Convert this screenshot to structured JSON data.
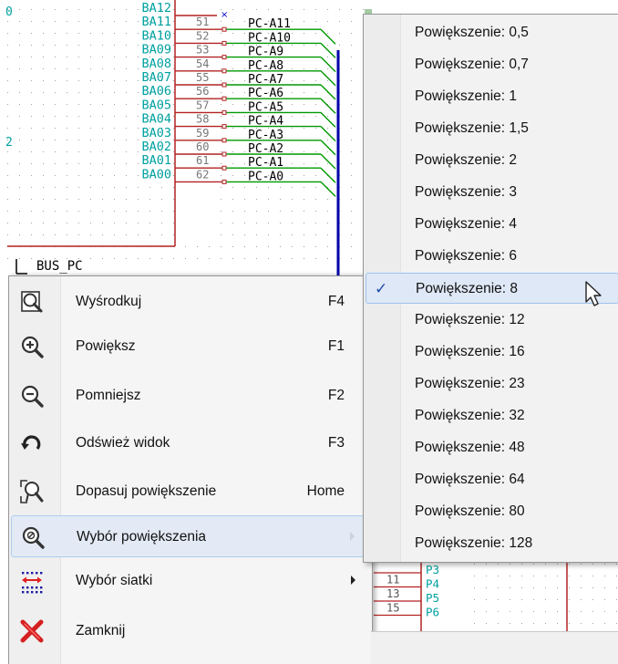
{
  "schematic": {
    "bus_label": "BUS_PC",
    "left_edge_labels": [
      "0",
      "2"
    ],
    "bus_entries": [
      {
        "pin_name": "BA12",
        "pin_num": "",
        "net": ""
      },
      {
        "pin_name": "BA11",
        "pin_num": "51",
        "net": "PC-A11"
      },
      {
        "pin_name": "BA10",
        "pin_num": "52",
        "net": "PC-A10"
      },
      {
        "pin_name": "BA09",
        "pin_num": "53",
        "net": "PC-A9"
      },
      {
        "pin_name": "BA08",
        "pin_num": "54",
        "net": "PC-A8"
      },
      {
        "pin_name": "BA07",
        "pin_num": "55",
        "net": "PC-A7"
      },
      {
        "pin_name": "BA06",
        "pin_num": "56",
        "net": "PC-A6"
      },
      {
        "pin_name": "BA05",
        "pin_num": "57",
        "net": "PC-A5"
      },
      {
        "pin_name": "BA04",
        "pin_num": "58",
        "net": "PC-A4"
      },
      {
        "pin_name": "BA03",
        "pin_num": "59",
        "net": "PC-A3"
      },
      {
        "pin_name": "BA02",
        "pin_num": "60",
        "net": "PC-A2"
      },
      {
        "pin_name": "BA01",
        "pin_num": "61",
        "net": "PC-A1"
      },
      {
        "pin_name": "BA00",
        "pin_num": "62",
        "net": "PC-A0"
      }
    ],
    "lower_pins": [
      {
        "num": "",
        "name": "P3"
      },
      {
        "num": "11",
        "name": "P4"
      },
      {
        "num": "13",
        "name": "P5"
      },
      {
        "num": "15",
        "name": "P6"
      }
    ],
    "colors": {
      "component": "#b22222",
      "wire": "#009900",
      "bus": "#0000aa",
      "pin_text": "#00a0a0",
      "net_text": "#000000",
      "bus_label": "#800080",
      "grid_dot": "#a0a0a0"
    }
  },
  "context_menu": {
    "items": [
      {
        "icon": "zoom-center-icon",
        "label": "Wyśrodkuj",
        "shortcut": "F4"
      },
      {
        "icon": "zoom-in-icon",
        "label": "Powiększ",
        "shortcut": "F1"
      },
      {
        "icon": "zoom-out-icon",
        "label": "Pomniejsz",
        "shortcut": "F2"
      },
      {
        "icon": "redraw-icon",
        "label": "Odśwież widok",
        "shortcut": "F3"
      },
      {
        "icon": "zoom-fit-icon",
        "label": "Dopasuj powiększenie",
        "shortcut": "Home"
      },
      {
        "icon": "zoom-select-icon",
        "label": "Wybór powiększenia",
        "shortcut": "",
        "submenu": true,
        "highlighted": true
      },
      {
        "icon": "grid-select-icon",
        "label": "Wybór siatki",
        "shortcut": "",
        "submenu": true
      },
      {
        "icon": "close-icon",
        "label": "Zamknij",
        "shortcut": ""
      }
    ]
  },
  "zoom_submenu": {
    "items": [
      {
        "label": "Powiększenie: 0,5"
      },
      {
        "label": "Powiększenie: 0,7"
      },
      {
        "label": "Powiększenie: 1"
      },
      {
        "label": "Powiększenie: 1,5"
      },
      {
        "label": "Powiększenie: 2"
      },
      {
        "label": "Powiększenie: 3"
      },
      {
        "label": "Powiększenie: 4"
      },
      {
        "label": "Powiększenie: 6"
      },
      {
        "label": "Powiększenie: 8",
        "checked": true,
        "highlighted": true
      },
      {
        "label": "Powiększenie: 12"
      },
      {
        "label": "Powiększenie: 16"
      },
      {
        "label": "Powiększenie: 23"
      },
      {
        "label": "Powiększenie: 32"
      },
      {
        "label": "Powiększenie: 48"
      },
      {
        "label": "Powiększenie: 64"
      },
      {
        "label": "Powiększenie: 80"
      },
      {
        "label": "Powiększenie: 128"
      }
    ],
    "check_glyph": "✓"
  }
}
